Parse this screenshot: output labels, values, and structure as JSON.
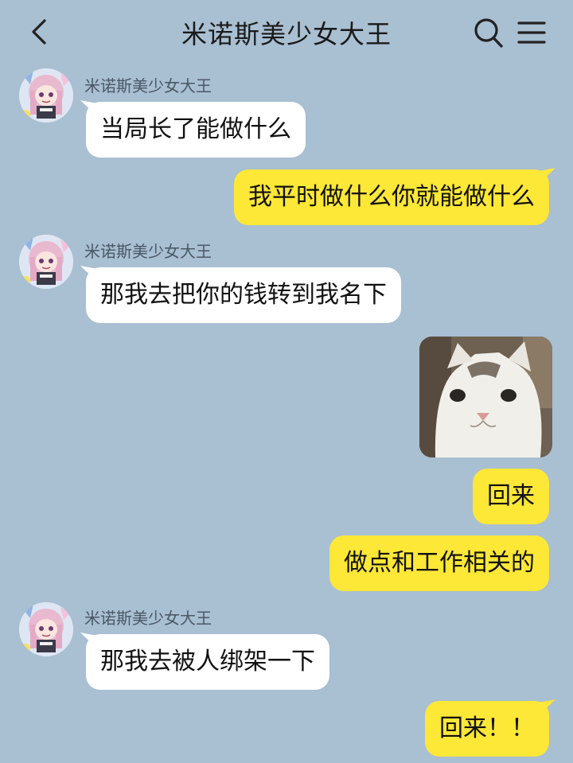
{
  "header": {
    "title": "米诺斯美少女大王",
    "back_icon": "chevron-left-icon",
    "search_icon": "search-icon",
    "menu_icon": "hamburger-menu-icon"
  },
  "colors": {
    "background": "#a9bfd2",
    "incoming_bubble": "#ffffff",
    "outgoing_bubble": "#fde737"
  },
  "messages": [
    {
      "direction": "in",
      "sender": "米诺斯美少女大王",
      "text": "当局长了能做什么"
    },
    {
      "direction": "out",
      "text": "我平时做什么你就能做什么"
    },
    {
      "direction": "in",
      "sender": "米诺斯美少女大王",
      "text": "那我去把你的钱转到我名下"
    },
    {
      "direction": "out",
      "type": "sticker",
      "sticker": "cat-face-sticker"
    },
    {
      "direction": "out",
      "text": "回来"
    },
    {
      "direction": "out",
      "text": "做点和工作相关的"
    },
    {
      "direction": "in",
      "sender": "米诺斯美少女大王",
      "text": "那我去被人绑架一下"
    },
    {
      "direction": "out",
      "text": "回来！！"
    }
  ]
}
